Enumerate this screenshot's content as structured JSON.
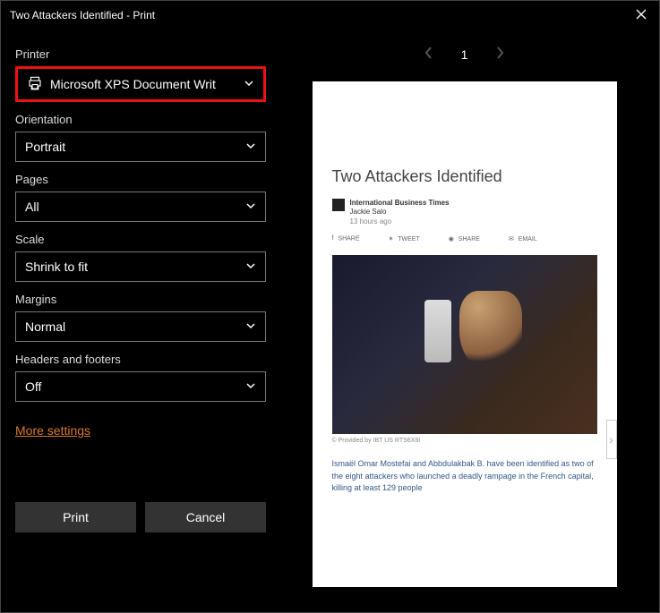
{
  "window": {
    "title": "Two Attackers Identified - Print"
  },
  "panel": {
    "printer": {
      "label": "Printer",
      "value": "Microsoft XPS Document Writ"
    },
    "orientation": {
      "label": "Orientation",
      "value": "Portrait"
    },
    "pages": {
      "label": "Pages",
      "value": "All"
    },
    "scale": {
      "label": "Scale",
      "value": "Shrink to fit"
    },
    "margins": {
      "label": "Margins",
      "value": "Normal"
    },
    "headersFooters": {
      "label": "Headers and footers",
      "value": "Off"
    },
    "moreSettings": "More settings",
    "buttons": {
      "print": "Print",
      "cancel": "Cancel"
    }
  },
  "pager": {
    "current": "1"
  },
  "article": {
    "title": "Two Attackers Identified",
    "publisher": "International Business Times",
    "author": "Jackie Salo",
    "time": "13 hours ago",
    "share": {
      "share": "SHARE",
      "tweet": "TWEET",
      "share2": "SHARE",
      "email": "EMAIL"
    },
    "credit": "© Provided by IBT US   RTS6X8I",
    "body": "Ismaël Omar Mostefai and Abbdulakbak B. have been identified as two of the eight attackers who launched a deadly rampage in the French capital, killing at least 129 people"
  }
}
